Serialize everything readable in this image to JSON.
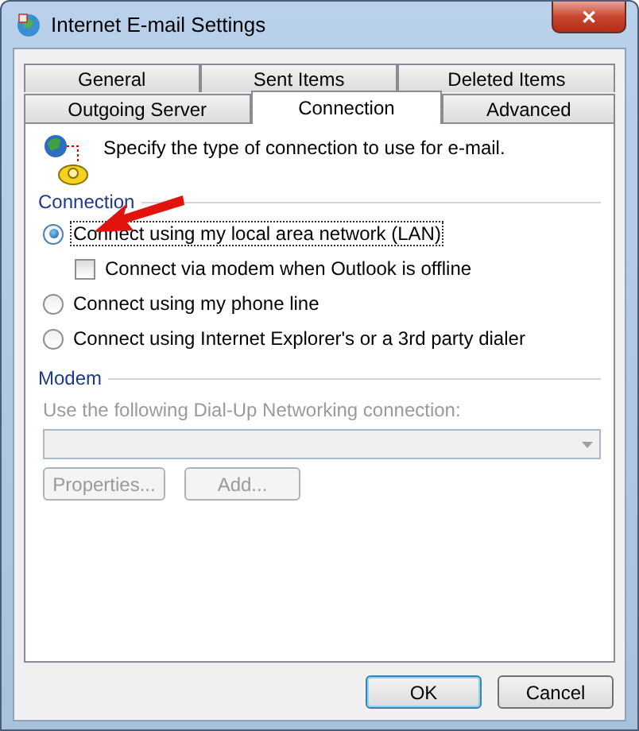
{
  "window": {
    "title": "Internet E-mail Settings",
    "close": "✕"
  },
  "tab_rows": [
    [
      {
        "label": "General",
        "selected": false
      },
      {
        "label": "Sent Items",
        "selected": false
      },
      {
        "label": "Deleted Items",
        "selected": false
      }
    ],
    [
      {
        "label": "Outgoing Server",
        "selected": false
      },
      {
        "label": "Connection",
        "selected": true
      },
      {
        "label": "Advanced",
        "selected": false
      }
    ]
  ],
  "intro": "Specify the type of connection to use for e-mail.",
  "connection": {
    "heading": "Connection",
    "options": [
      {
        "kind": "radio",
        "label": "Connect using my local area network (LAN)",
        "selected": true,
        "focused": true
      },
      {
        "kind": "checkbox",
        "label": "Connect via modem when Outlook is offline",
        "checked": false
      },
      {
        "kind": "radio",
        "label": "Connect using my phone line",
        "selected": false,
        "focused": false
      },
      {
        "kind": "radio",
        "label": "Connect using Internet Explorer's or a 3rd party dialer",
        "selected": false,
        "focused": false
      }
    ]
  },
  "modem": {
    "heading": "Modem",
    "disabled": true,
    "field_label": "Use the following Dial-Up Networking connection:",
    "buttons": [
      "Properties...",
      "Add..."
    ]
  },
  "buttons": [
    "OK",
    "Cancel"
  ]
}
